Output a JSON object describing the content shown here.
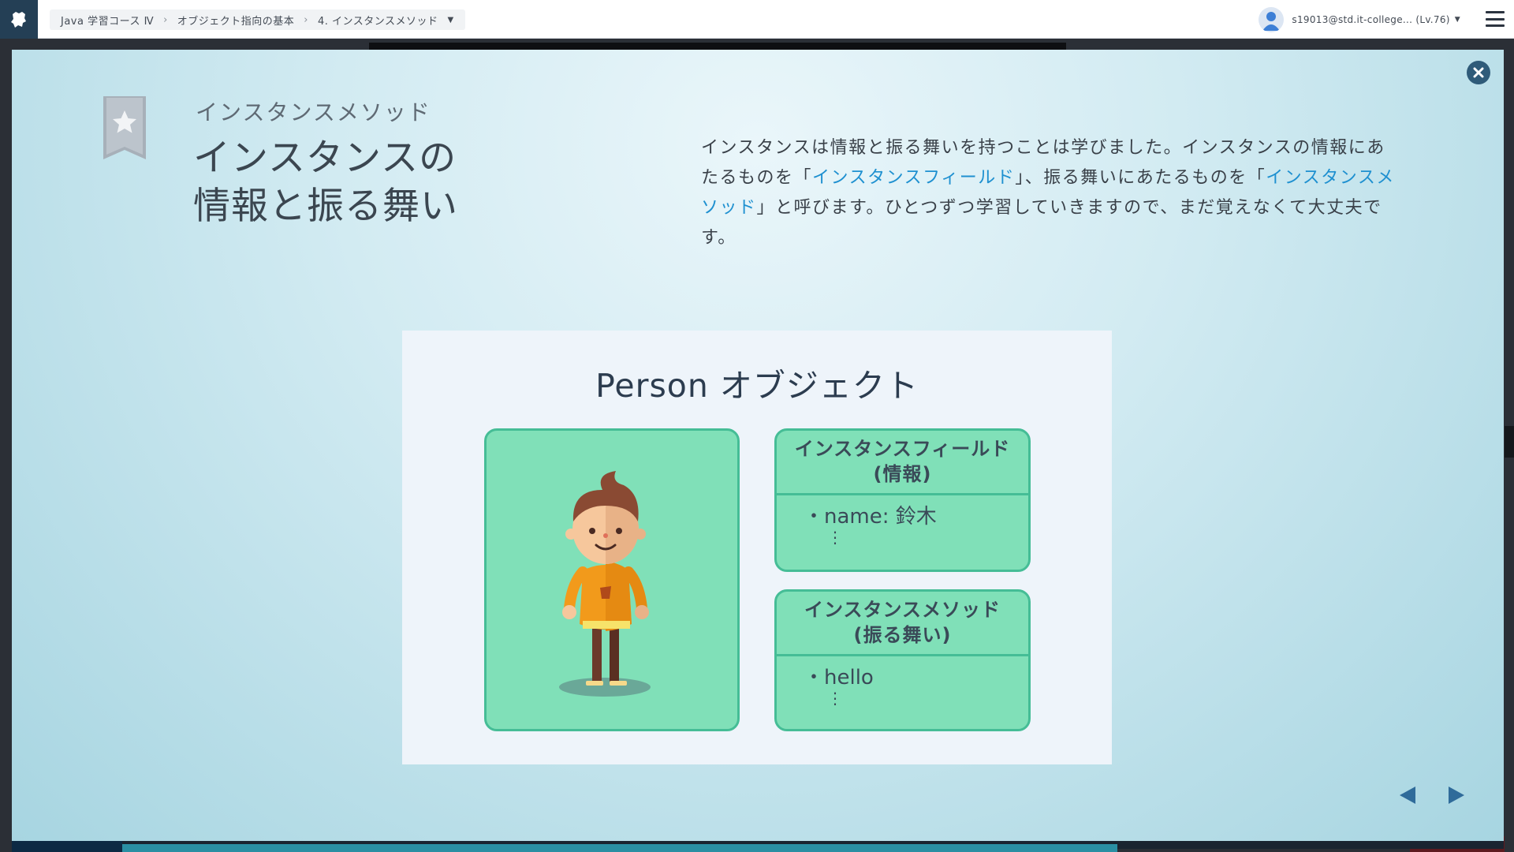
{
  "topbar": {
    "breadcrumb": [
      "Java 学習コース Ⅳ",
      "オブジェクト指向の基本",
      "4. インスタンスメソッド"
    ],
    "user_label": "s19013@std.it-college... (Lv.76)"
  },
  "lesson": {
    "subtitle": "インスタンスメソッド",
    "title_line1": "インスタンスの",
    "title_line2": "情報と振る舞い",
    "desc_part1": "インスタンスは情報と振る舞いを持つことは学びました。インスタンスの情報にあたるものを「",
    "desc_link1": "インスタンスフィールド",
    "desc_part2": "」、振る舞いにあたるものを「",
    "desc_link2": "インスタンスメソッド",
    "desc_part3": "」と呼びます。ひとつずつ学習していきますので、まだ覚えなくて大丈夫です。"
  },
  "slide": {
    "title": "Person オブジェクト",
    "field_card": {
      "head_line1": "インスタンスフィールド",
      "head_line2": "(情報)",
      "item": "・name: 鈴木",
      "more": "⋮"
    },
    "method_card": {
      "head_line1": "インスタンスメソッド",
      "head_line2": "(振る舞い)",
      "item": "・hello",
      "more": "⋮"
    }
  },
  "icons": {
    "brand": "logo-icon",
    "close": "close-icon",
    "bookmark": "star-bookmark-icon",
    "prev": "arrow-left-icon",
    "next": "arrow-right-icon",
    "menu": "hamburger-menu-icon"
  },
  "colors": {
    "accent_link": "#1e90d0",
    "card_fill": "#80e0b8",
    "card_border": "#45bd96",
    "nav_arrow": "#2f6b9a"
  }
}
